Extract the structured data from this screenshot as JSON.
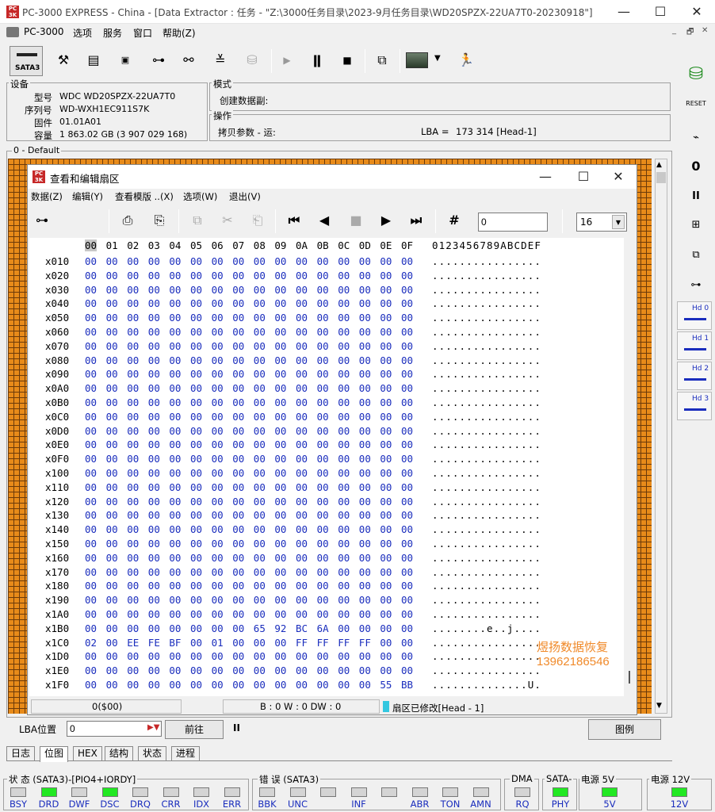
{
  "window": {
    "title": "PC-3000 EXPRESS - China - [Data Extractor : 任务 - \"Z:\\3000任务目录\\2023-9月任务目录\\WD20SPZX-22UA7T0-20230918\"]",
    "min": "—",
    "max": "☐",
    "close": "✕",
    "app_icon": "PC\n3000"
  },
  "menu": {
    "items": [
      "PC-3000",
      "选项",
      "服务",
      "窗口",
      "帮助(Z)"
    ],
    "mdi_buttons": [
      "_",
      "🗗",
      "✕"
    ]
  },
  "toolbar": {
    "sata_label": "SATA3"
  },
  "device": {
    "group_label": "设备",
    "rows": [
      {
        "k": "型号",
        "v": "WDC WD20SPZX-22UA7T0"
      },
      {
        "k": "序列号",
        "v": "WD-WXH1EC911S7K"
      },
      {
        "k": "固件",
        "v": "01.01A01"
      },
      {
        "k": "容量",
        "v": "1 863.02 GB (3 907 029 168)"
      }
    ]
  },
  "mode": {
    "group_label": "模式",
    "value": "创建数据副:"
  },
  "ops": {
    "group_label": "操作",
    "value": "拷贝参数 - 运:",
    "lba_label": "LBA =",
    "lba_value": "173 314  [Head-1]"
  },
  "default_label": "0 - Default",
  "dialog": {
    "title": "查看和编辑扇区",
    "icon": "PC\n3000",
    "min": "—",
    "max": "☐",
    "close": "✕",
    "menu": [
      "数据(Z)",
      "编辑(Y)",
      "查看模版 ..(X)",
      "选项(W)",
      "退出(V)"
    ],
    "search_value": "0",
    "width_value": "16"
  },
  "hex": {
    "header_cols": [
      "00",
      "01",
      "02",
      "03",
      "04",
      "05",
      "06",
      "07",
      "08",
      "09",
      "0A",
      "0B",
      "0C",
      "0D",
      "0E",
      "0F"
    ],
    "ascii_header": "0123456789ABCDEF",
    "rows": [
      {
        "off": "x010",
        "bytes": [
          "00",
          "00",
          "00",
          "00",
          "00",
          "00",
          "00",
          "00",
          "00",
          "00",
          "00",
          "00",
          "00",
          "00",
          "00",
          "00"
        ],
        "ascii": "................"
      },
      {
        "off": "x020",
        "bytes": [
          "00",
          "00",
          "00",
          "00",
          "00",
          "00",
          "00",
          "00",
          "00",
          "00",
          "00",
          "00",
          "00",
          "00",
          "00",
          "00"
        ],
        "ascii": "................"
      },
      {
        "off": "x030",
        "bytes": [
          "00",
          "00",
          "00",
          "00",
          "00",
          "00",
          "00",
          "00",
          "00",
          "00",
          "00",
          "00",
          "00",
          "00",
          "00",
          "00"
        ],
        "ascii": "................"
      },
      {
        "off": "x040",
        "bytes": [
          "00",
          "00",
          "00",
          "00",
          "00",
          "00",
          "00",
          "00",
          "00",
          "00",
          "00",
          "00",
          "00",
          "00",
          "00",
          "00"
        ],
        "ascii": "................"
      },
      {
        "off": "x050",
        "bytes": [
          "00",
          "00",
          "00",
          "00",
          "00",
          "00",
          "00",
          "00",
          "00",
          "00",
          "00",
          "00",
          "00",
          "00",
          "00",
          "00"
        ],
        "ascii": "................"
      },
      {
        "off": "x060",
        "bytes": [
          "00",
          "00",
          "00",
          "00",
          "00",
          "00",
          "00",
          "00",
          "00",
          "00",
          "00",
          "00",
          "00",
          "00",
          "00",
          "00"
        ],
        "ascii": "................"
      },
      {
        "off": "x070",
        "bytes": [
          "00",
          "00",
          "00",
          "00",
          "00",
          "00",
          "00",
          "00",
          "00",
          "00",
          "00",
          "00",
          "00",
          "00",
          "00",
          "00"
        ],
        "ascii": "................"
      },
      {
        "off": "x080",
        "bytes": [
          "00",
          "00",
          "00",
          "00",
          "00",
          "00",
          "00",
          "00",
          "00",
          "00",
          "00",
          "00",
          "00",
          "00",
          "00",
          "00"
        ],
        "ascii": "................"
      },
      {
        "off": "x090",
        "bytes": [
          "00",
          "00",
          "00",
          "00",
          "00",
          "00",
          "00",
          "00",
          "00",
          "00",
          "00",
          "00",
          "00",
          "00",
          "00",
          "00"
        ],
        "ascii": "................"
      },
      {
        "off": "x0A0",
        "bytes": [
          "00",
          "00",
          "00",
          "00",
          "00",
          "00",
          "00",
          "00",
          "00",
          "00",
          "00",
          "00",
          "00",
          "00",
          "00",
          "00"
        ],
        "ascii": "................"
      },
      {
        "off": "x0B0",
        "bytes": [
          "00",
          "00",
          "00",
          "00",
          "00",
          "00",
          "00",
          "00",
          "00",
          "00",
          "00",
          "00",
          "00",
          "00",
          "00",
          "00"
        ],
        "ascii": "................"
      },
      {
        "off": "x0C0",
        "bytes": [
          "00",
          "00",
          "00",
          "00",
          "00",
          "00",
          "00",
          "00",
          "00",
          "00",
          "00",
          "00",
          "00",
          "00",
          "00",
          "00"
        ],
        "ascii": "................"
      },
      {
        "off": "x0D0",
        "bytes": [
          "00",
          "00",
          "00",
          "00",
          "00",
          "00",
          "00",
          "00",
          "00",
          "00",
          "00",
          "00",
          "00",
          "00",
          "00",
          "00"
        ],
        "ascii": "................"
      },
      {
        "off": "x0E0",
        "bytes": [
          "00",
          "00",
          "00",
          "00",
          "00",
          "00",
          "00",
          "00",
          "00",
          "00",
          "00",
          "00",
          "00",
          "00",
          "00",
          "00"
        ],
        "ascii": "................"
      },
      {
        "off": "x0F0",
        "bytes": [
          "00",
          "00",
          "00",
          "00",
          "00",
          "00",
          "00",
          "00",
          "00",
          "00",
          "00",
          "00",
          "00",
          "00",
          "00",
          "00"
        ],
        "ascii": "................"
      },
      {
        "off": "x100",
        "bytes": [
          "00",
          "00",
          "00",
          "00",
          "00",
          "00",
          "00",
          "00",
          "00",
          "00",
          "00",
          "00",
          "00",
          "00",
          "00",
          "00"
        ],
        "ascii": "................"
      },
      {
        "off": "x110",
        "bytes": [
          "00",
          "00",
          "00",
          "00",
          "00",
          "00",
          "00",
          "00",
          "00",
          "00",
          "00",
          "00",
          "00",
          "00",
          "00",
          "00"
        ],
        "ascii": "................"
      },
      {
        "off": "x120",
        "bytes": [
          "00",
          "00",
          "00",
          "00",
          "00",
          "00",
          "00",
          "00",
          "00",
          "00",
          "00",
          "00",
          "00",
          "00",
          "00",
          "00"
        ],
        "ascii": "................"
      },
      {
        "off": "x130",
        "bytes": [
          "00",
          "00",
          "00",
          "00",
          "00",
          "00",
          "00",
          "00",
          "00",
          "00",
          "00",
          "00",
          "00",
          "00",
          "00",
          "00"
        ],
        "ascii": "................"
      },
      {
        "off": "x140",
        "bytes": [
          "00",
          "00",
          "00",
          "00",
          "00",
          "00",
          "00",
          "00",
          "00",
          "00",
          "00",
          "00",
          "00",
          "00",
          "00",
          "00"
        ],
        "ascii": "................"
      },
      {
        "off": "x150",
        "bytes": [
          "00",
          "00",
          "00",
          "00",
          "00",
          "00",
          "00",
          "00",
          "00",
          "00",
          "00",
          "00",
          "00",
          "00",
          "00",
          "00"
        ],
        "ascii": "................"
      },
      {
        "off": "x160",
        "bytes": [
          "00",
          "00",
          "00",
          "00",
          "00",
          "00",
          "00",
          "00",
          "00",
          "00",
          "00",
          "00",
          "00",
          "00",
          "00",
          "00"
        ],
        "ascii": "................"
      },
      {
        "off": "x170",
        "bytes": [
          "00",
          "00",
          "00",
          "00",
          "00",
          "00",
          "00",
          "00",
          "00",
          "00",
          "00",
          "00",
          "00",
          "00",
          "00",
          "00"
        ],
        "ascii": "................"
      },
      {
        "off": "x180",
        "bytes": [
          "00",
          "00",
          "00",
          "00",
          "00",
          "00",
          "00",
          "00",
          "00",
          "00",
          "00",
          "00",
          "00",
          "00",
          "00",
          "00"
        ],
        "ascii": "................"
      },
      {
        "off": "x190",
        "bytes": [
          "00",
          "00",
          "00",
          "00",
          "00",
          "00",
          "00",
          "00",
          "00",
          "00",
          "00",
          "00",
          "00",
          "00",
          "00",
          "00"
        ],
        "ascii": "................"
      },
      {
        "off": "x1A0",
        "bytes": [
          "00",
          "00",
          "00",
          "00",
          "00",
          "00",
          "00",
          "00",
          "00",
          "00",
          "00",
          "00",
          "00",
          "00",
          "00",
          "00"
        ],
        "ascii": "................"
      },
      {
        "off": "x1B0",
        "bytes": [
          "00",
          "00",
          "00",
          "00",
          "00",
          "00",
          "00",
          "00",
          "65",
          "92",
          "BC",
          "6A",
          "00",
          "00",
          "00",
          "00"
        ],
        "ascii": "........e..j...."
      },
      {
        "off": "x1C0",
        "bytes": [
          "02",
          "00",
          "EE",
          "FE",
          "BF",
          "00",
          "01",
          "00",
          "00",
          "00",
          "FF",
          "FF",
          "FF",
          "FF",
          "00",
          "00"
        ],
        "ascii": "................"
      },
      {
        "off": "x1D0",
        "bytes": [
          "00",
          "00",
          "00",
          "00",
          "00",
          "00",
          "00",
          "00",
          "00",
          "00",
          "00",
          "00",
          "00",
          "00",
          "00",
          "00"
        ],
        "ascii": "................"
      },
      {
        "off": "x1E0",
        "bytes": [
          "00",
          "00",
          "00",
          "00",
          "00",
          "00",
          "00",
          "00",
          "00",
          "00",
          "00",
          "00",
          "00",
          "00",
          "00",
          "00"
        ],
        "ascii": "................"
      },
      {
        "off": "x1F0",
        "bytes": [
          "00",
          "00",
          "00",
          "00",
          "00",
          "00",
          "00",
          "00",
          "00",
          "00",
          "00",
          "00",
          "00",
          "00",
          "55",
          "BB"
        ],
        "ascii": "..............U."
      }
    ]
  },
  "watermark": {
    "line1": "煜扬数据恢复",
    "line2": "13962186546",
    "color": "#f08a2a"
  },
  "dlg_status": {
    "pos": "0($00)",
    "bwd": "B : 0 W : 0 DW : 0",
    "modified": "扇区已修改[Head - 1]"
  },
  "lba_bar": {
    "label": "LBA位置",
    "value": "0",
    "go": "前往",
    "pause": "II",
    "legend": "图例"
  },
  "tabs": [
    "日志",
    "位图",
    "HEX",
    "结构",
    "状态",
    "进程"
  ],
  "status": {
    "state_group": "状 态 (SATA3)-[PIO4+IORDY]",
    "error_group": "错 误 (SATA3)",
    "dma_group": "DMA",
    "sata_group": "SATA-",
    "p5_group": "电源 5V",
    "p12_group": "电源 12V",
    "state_leds": [
      {
        "n": "BSY",
        "on": false
      },
      {
        "n": "DRD",
        "on": true
      },
      {
        "n": "DWF",
        "on": false
      },
      {
        "n": "DSC",
        "on": true
      },
      {
        "n": "DRQ",
        "on": false
      },
      {
        "n": "CRR",
        "on": false
      },
      {
        "n": "IDX",
        "on": false
      },
      {
        "n": "ERR",
        "on": false
      }
    ],
    "error_leds": [
      {
        "n": "BBK",
        "on": false
      },
      {
        "n": "UNC",
        "on": false
      },
      {
        "n": "",
        "on": false
      },
      {
        "n": "INF",
        "on": false
      },
      {
        "n": "",
        "on": false
      },
      {
        "n": "ABR",
        "on": false
      },
      {
        "n": "TON",
        "on": false
      },
      {
        "n": "AMN",
        "on": false
      }
    ],
    "dma_led": {
      "n": "RQ",
      "on": false
    },
    "sata_led": {
      "n": "PHY",
      "on": true
    },
    "p5_led": {
      "n": "5V",
      "on": true
    },
    "p12_led": {
      "n": "12V",
      "on": true
    }
  },
  "right_toolbar": {
    "hd_labels": [
      "Hd 0",
      "Hd 1",
      "Hd 2",
      "Hd 3"
    ],
    "reset": "RESET",
    "pause": "II"
  }
}
